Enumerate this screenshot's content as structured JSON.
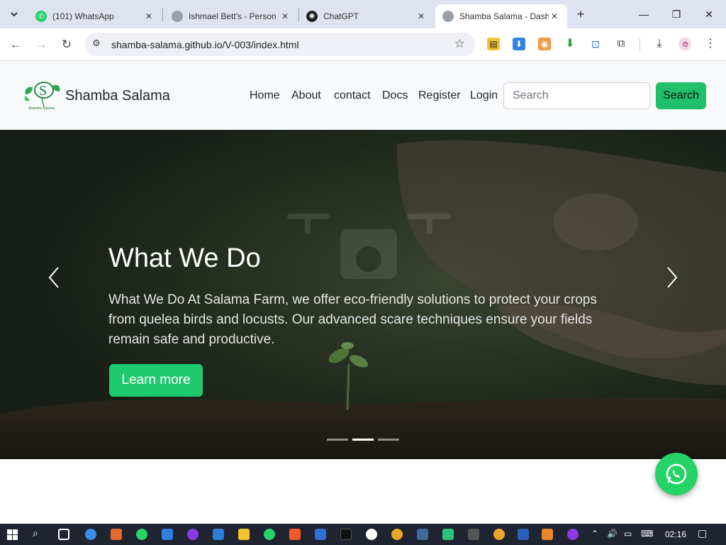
{
  "browser": {
    "tabs": [
      {
        "title": "(101) WhatsApp",
        "active": false
      },
      {
        "title": "Ishmael Bett's - Person",
        "active": false
      },
      {
        "title": "ChatGPT",
        "active": false
      },
      {
        "title": "Shamba Salama - Dash",
        "active": true
      }
    ],
    "url": "shamba-salama.github.io/V-003/index.html"
  },
  "site": {
    "brand": "Shamba Salama",
    "logo_caption": "Shamba Salama",
    "nav": [
      "Home",
      "About",
      "contact",
      "Docs",
      "Register",
      "Login"
    ],
    "search_placeholder": "Search",
    "search_button": "Search"
  },
  "hero": {
    "title": "What We Do",
    "text": "What We Do At Salama Farm, we offer eco-friendly solutions to protect your crops from quelea birds and locusts. Our advanced scare techniques ensure your fields remain safe and productive.",
    "button": "Learn more",
    "slides": 3,
    "active_slide": 2
  },
  "colors": {
    "accent": "#20c06a",
    "navbar_bg": "#f8f9fa",
    "whatsapp": "#25d366"
  },
  "taskbar": {
    "time": "02:16"
  }
}
